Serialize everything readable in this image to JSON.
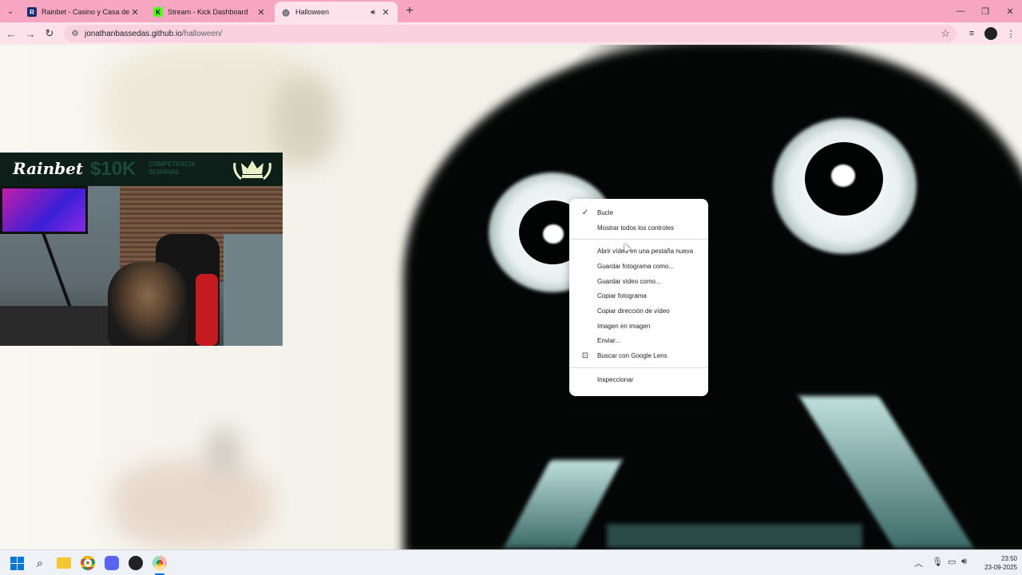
{
  "browser": {
    "tabs": [
      {
        "title": "Rainbet - Casino y Casa de Apuestas",
        "favicon": "rainbet-favicon",
        "favicon_color": "#1a2b6e",
        "active": false
      },
      {
        "title": "Stream - Kick Dashboard",
        "favicon": "kick-favicon",
        "favicon_color": "#53fc18",
        "active": false
      },
      {
        "title": "Halloween",
        "favicon": "globe-favicon",
        "favicon_color": "#5f6368",
        "active": true,
        "audio": true
      }
    ],
    "address": "jonathanbassedas.github.io/halloween/",
    "address_host": "jonathanbassedas.github.io",
    "address_path": "/halloween/",
    "tabstrip_color": "#f6a6c0",
    "toolbar_color": "#fde2ec"
  },
  "stream_overlay": {
    "logo": "Rainbet",
    "prize": "$10K",
    "prize_sub_line1": "COMPETENCIA",
    "prize_sub_line2": "SEMANAL"
  },
  "context_menu": {
    "items": [
      {
        "label": "Bucle",
        "checked": true
      },
      {
        "label": "Mostrar todos los controles"
      },
      {
        "separator": true
      },
      {
        "label": "Abrir vídeo en una pestaña nueva"
      },
      {
        "label": "Guardar fotograma como..."
      },
      {
        "label": "Guardar vídeo como..."
      },
      {
        "label": "Copiar fotograma"
      },
      {
        "label": "Copiar dirección de vídeo"
      },
      {
        "label": "Imagen en imagen"
      },
      {
        "label": "Enviar..."
      },
      {
        "label": "Buscar con Google Lens",
        "icon": "google-lens-icon"
      },
      {
        "separator": true
      },
      {
        "label": "Inspeccionar"
      }
    ]
  },
  "taskbar": {
    "time": "23:50",
    "date": "23-09-2025"
  }
}
